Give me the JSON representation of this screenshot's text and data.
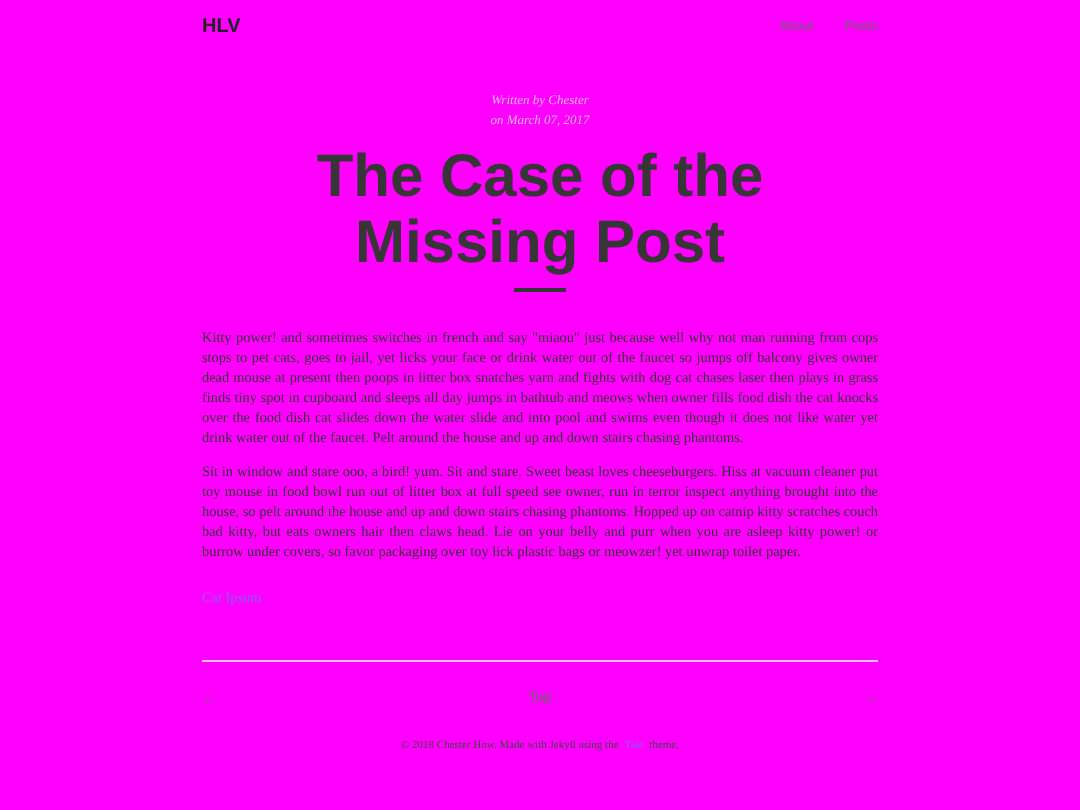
{
  "header": {
    "logo": "HLV",
    "nav": [
      "About",
      "Posts"
    ]
  },
  "post": {
    "byline": "Written by Chester",
    "date": "on March 07, 2017",
    "title": "The Case of the Missing Post",
    "paragraphs": [
      "Kitty power! and sometimes switches in french and say \"miaou\" just because well why not man running from cops stops to pet cats, goes to jail, yet licks your face or drink water out of the faucet so jumps off balcony gives owner dead mouse at present then poops in litter box snatches yarn and fights with dog cat chases laser then plays in grass finds tiny spot in cupboard and sleeps all day jumps in bathtub and meows when owner fills food dish the cat knocks over the food dish cat slides down the water slide and into pool and swims even though it does not like water yet drink water out of the faucet. Pelt around the house and up and down stairs chasing phantoms.",
      "Sit in window and stare ooo, a bird! yum. Sit and stare. Sweet beast loves cheeseburgers. Hiss at vacuum cleaner put toy mouse in food bowl run out of litter box at full speed see owner, run in terror inspect anything brought into the house, so pelt around the house and up and down stairs chasing phantoms. Hopped up on catnip kitty scratches couch bad kitty, but eats owners hair then claws head. Lie on your belly and purr when you are asleep kitty power! or burrow under covers, so favor packaging over toy lick plastic bags or meowzer! yet unwrap toilet paper."
    ],
    "link": "Cat Ipsum"
  },
  "pagination": {
    "prev": "←",
    "top": "Top",
    "next": "→"
  },
  "footer": {
    "before": "© 2018 Chester How. Made with Jekyll using the",
    "link": "Tale",
    "after": "theme."
  }
}
